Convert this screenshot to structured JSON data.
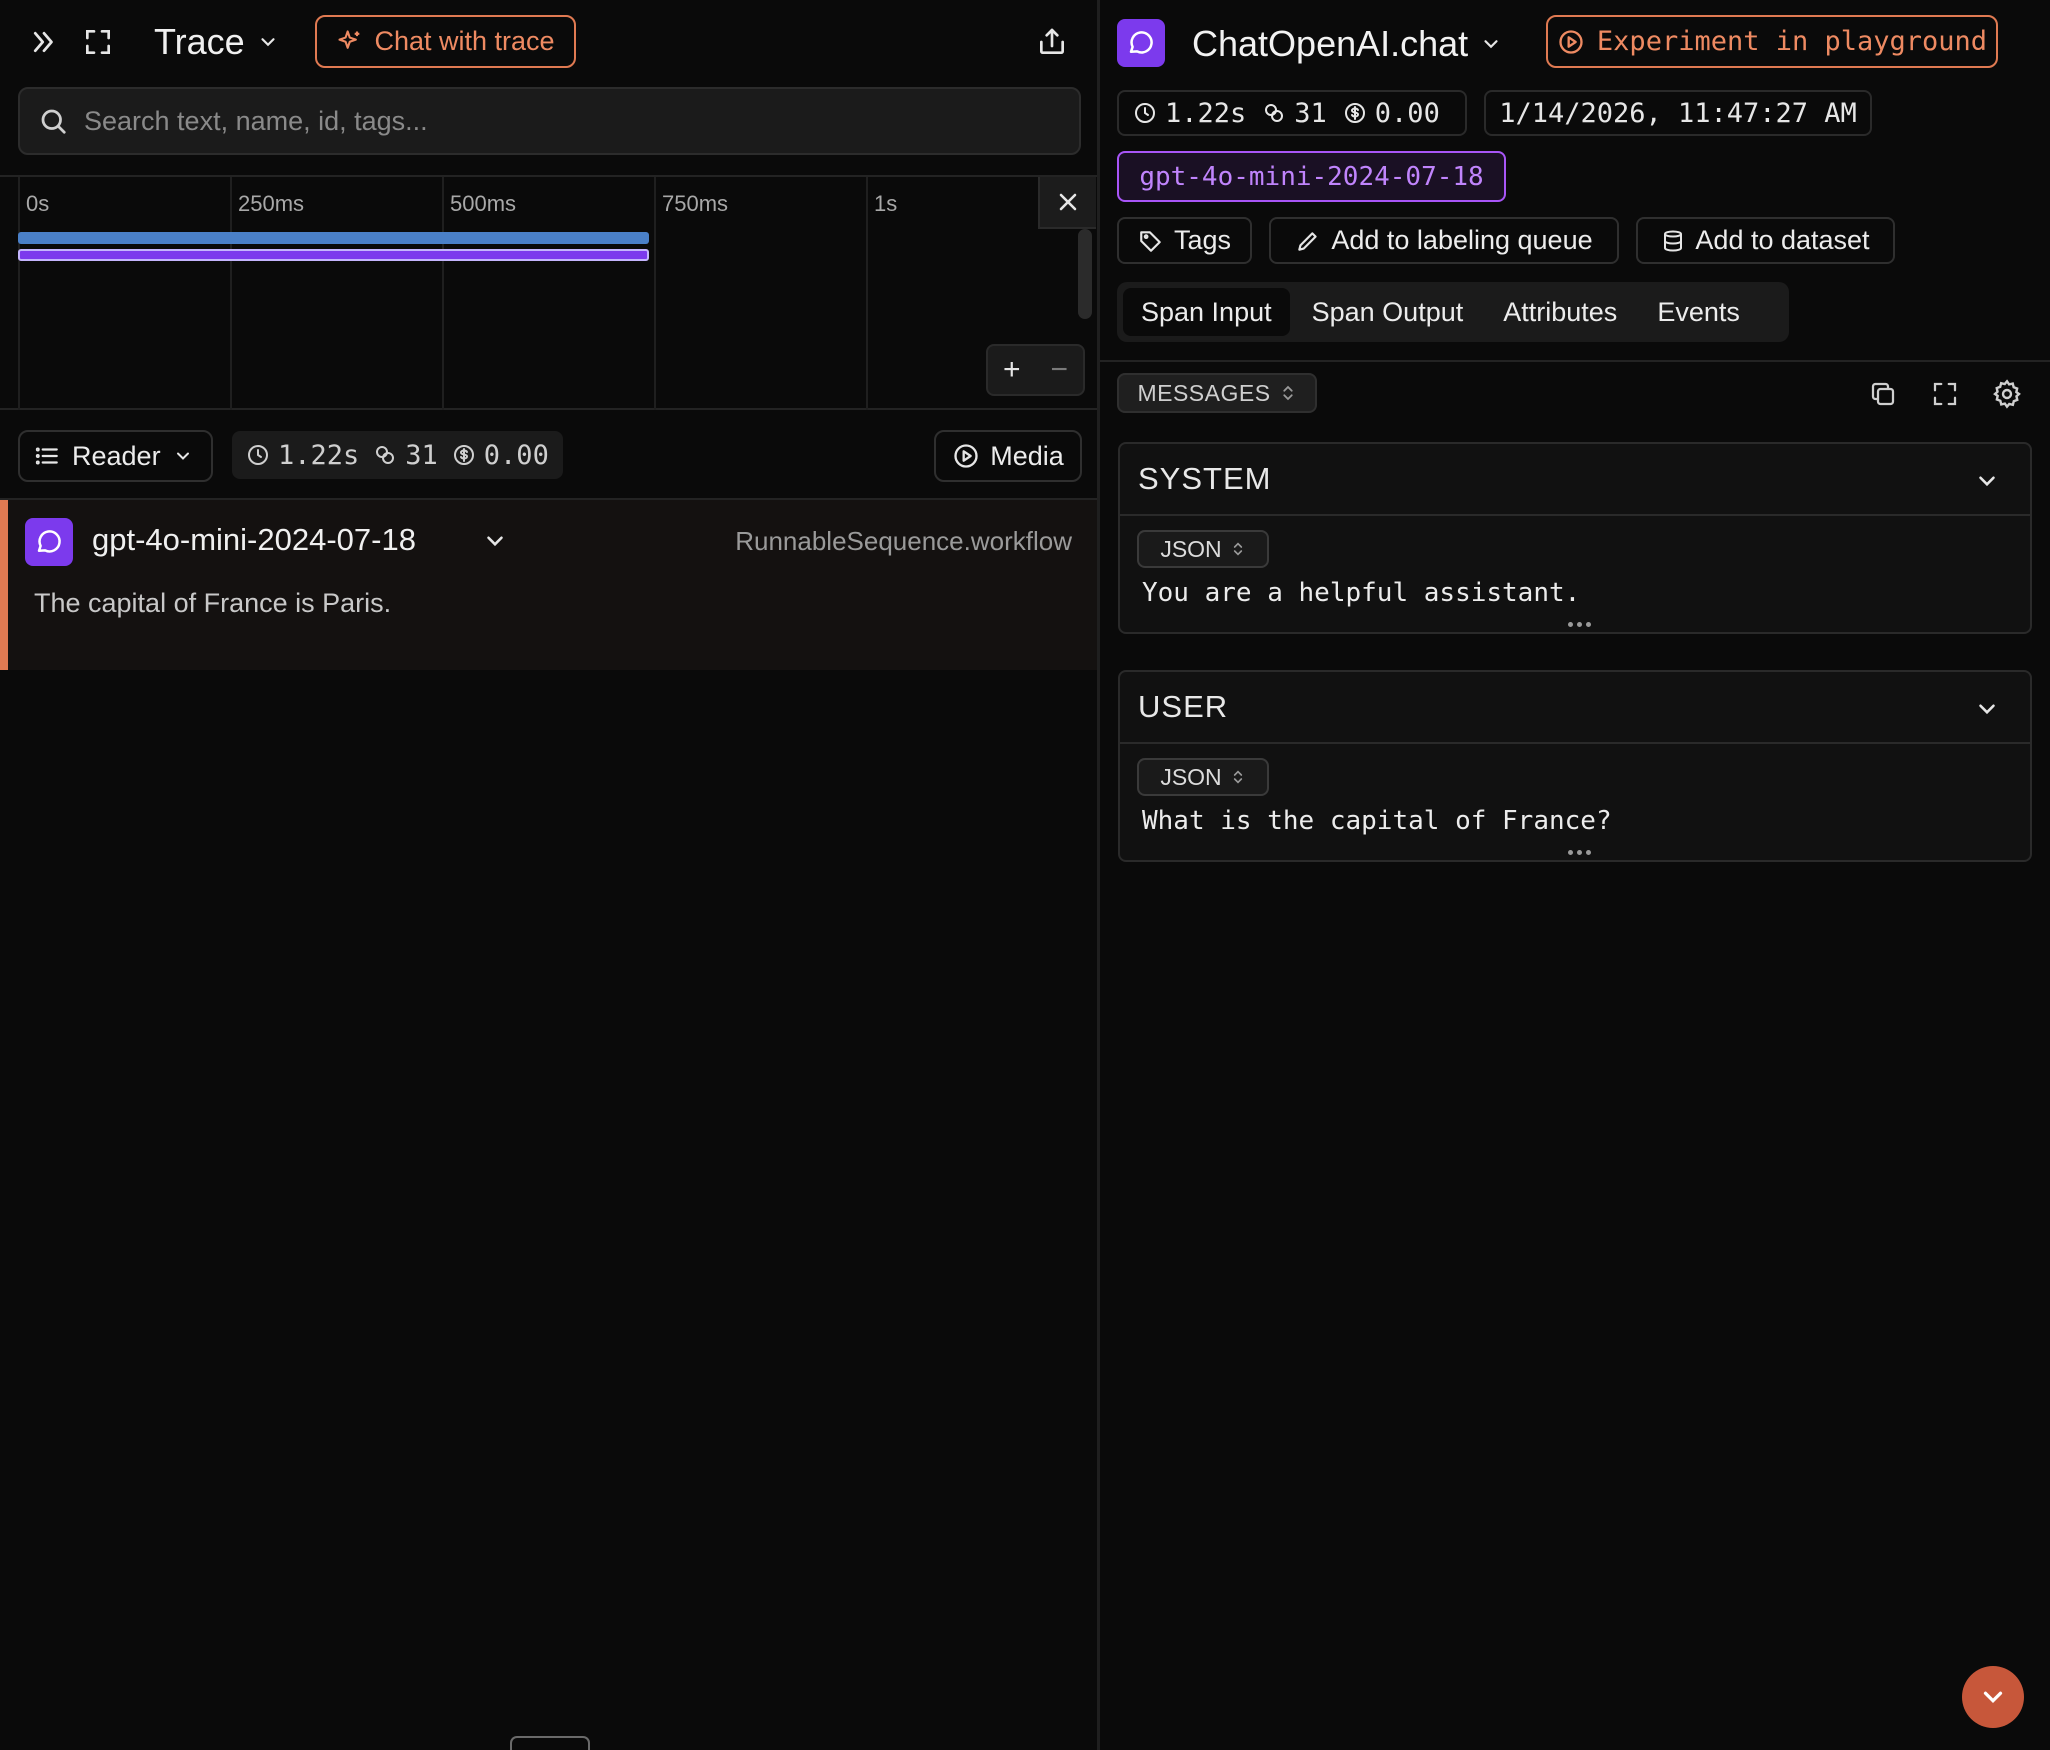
{
  "left": {
    "title": "Trace",
    "chat_button_label": "Chat with trace",
    "search": {
      "placeholder": "Search text, name, id, tags..."
    },
    "timeline": {
      "ticks": [
        "0s",
        "250ms",
        "500ms",
        "750ms",
        "1s"
      ],
      "zoom_in": "+",
      "zoom_out": "−"
    },
    "view_mode": "Reader",
    "stats": {
      "latency": "1.22s",
      "tokens": "31",
      "cost": "0.00"
    },
    "media_label": "Media",
    "span": {
      "name": "gpt-4o-mini-2024-07-18",
      "kind": "RunnableSequence.workflow",
      "output": "The capital of France is Paris."
    }
  },
  "right": {
    "title": "ChatOpenAI.chat",
    "experiment_label": "Experiment in playground",
    "stats": {
      "latency": "1.22s",
      "tokens": "31",
      "cost": "0.00"
    },
    "timestamp": "1/14/2026, 11:47:27 AM",
    "model": "gpt-4o-mini-2024-07-18",
    "actions": {
      "tags": "Tags",
      "labeling": "Add to labeling queue",
      "dataset": "Add to dataset"
    },
    "tabs": [
      "Span Input",
      "Span Output",
      "Attributes",
      "Events"
    ],
    "active_tab": "Span Input",
    "format_selector": "MESSAGES",
    "messages": [
      {
        "role": "SYSTEM",
        "format": "JSON",
        "content": "You are a helpful assistant."
      },
      {
        "role": "USER",
        "format": "JSON",
        "content": "What is the capital of France?"
      }
    ]
  },
  "colors": {
    "accent": "#e07a52",
    "purple": "#7c3aed",
    "timeline_bar_blue": "#4a80c8",
    "background": "#0a0a0a"
  },
  "icons": [
    "expand-chevrons-icon",
    "fullscreen-icon",
    "chevron-down-icon",
    "sparkle-icon",
    "share-icon",
    "search-icon",
    "close-icon",
    "list-icon",
    "clock-icon",
    "tokens-icon",
    "dollar-icon",
    "play-circle-icon",
    "chat-bubble-icon",
    "tag-icon",
    "pencil-icon",
    "database-icon",
    "sort-icon",
    "copy-icon",
    "settings-icon"
  ]
}
